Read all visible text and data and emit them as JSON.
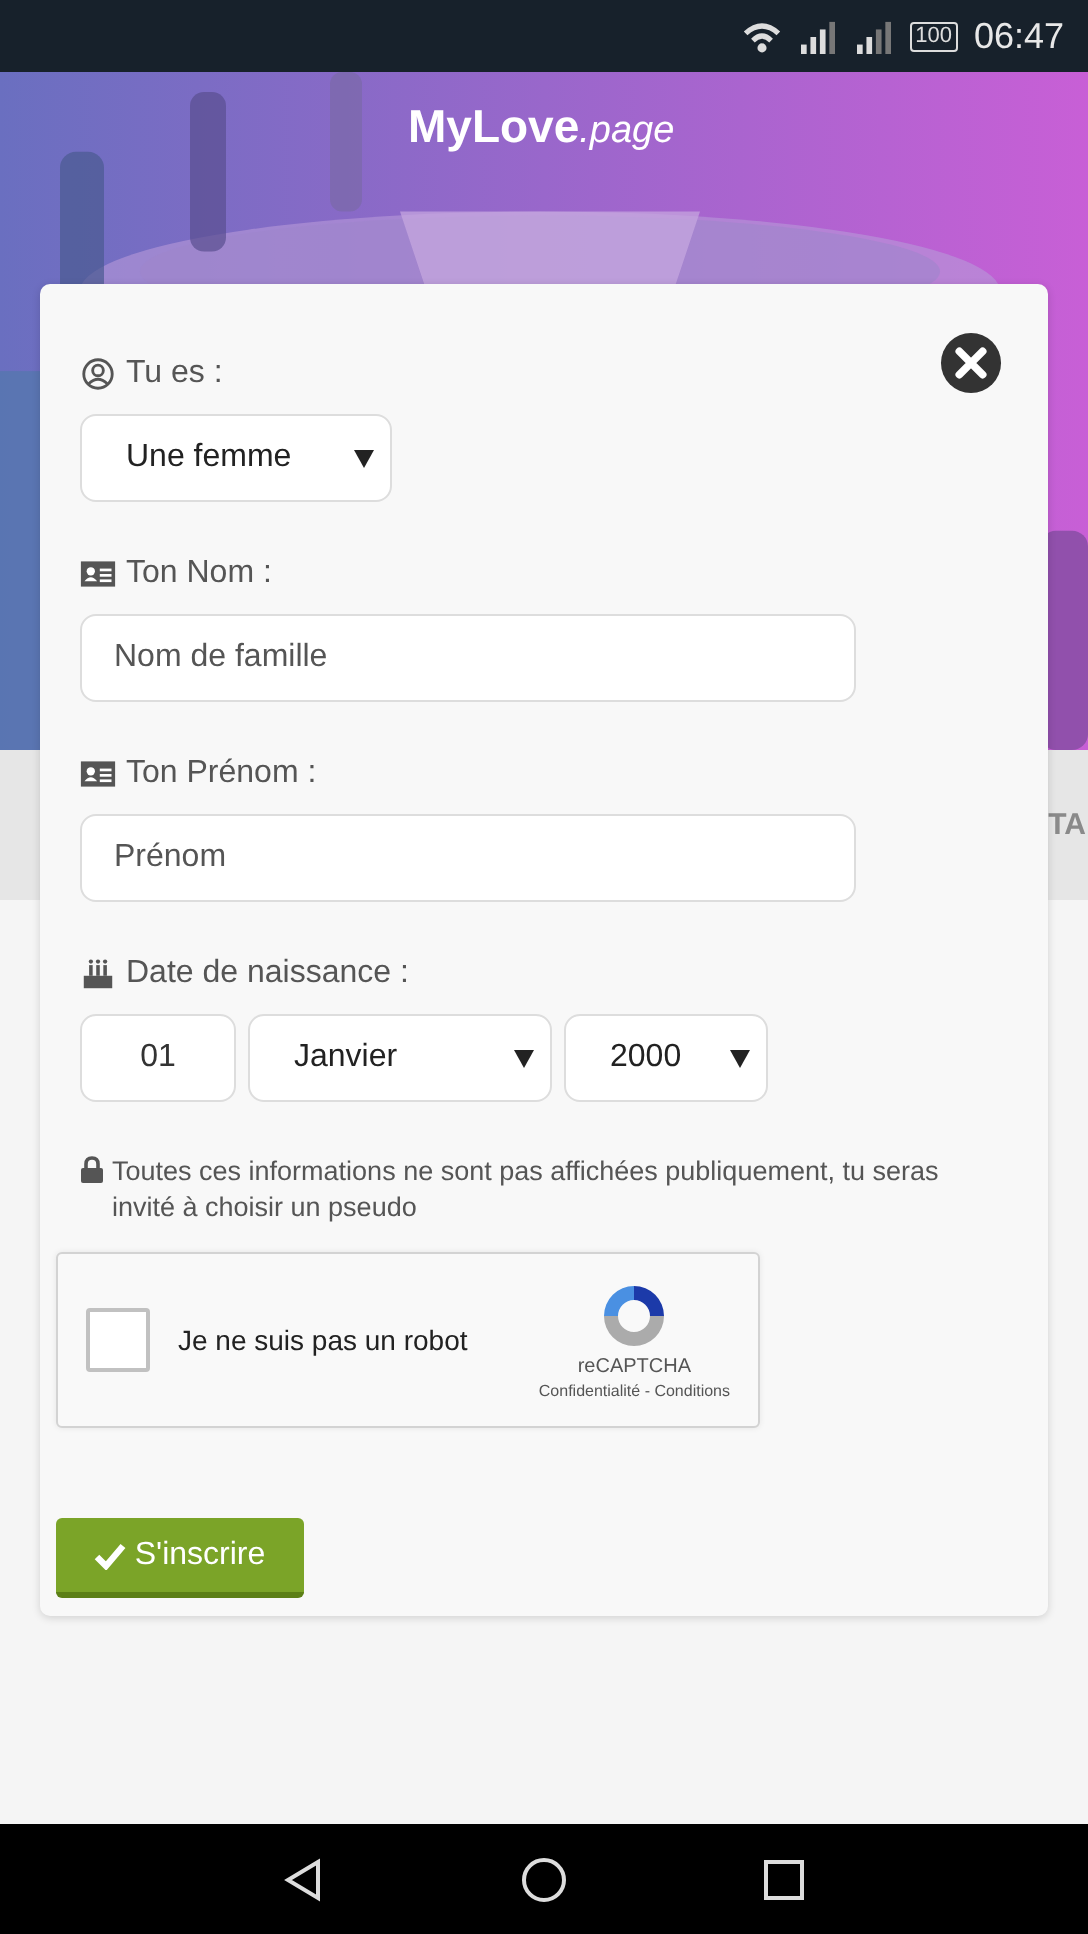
{
  "status_bar": {
    "battery": "100",
    "time": "06:47"
  },
  "header": {
    "logo": "MyLove",
    "logo_suffix": ".page"
  },
  "background_text": "TA",
  "form": {
    "sections": [
      {
        "kind": "gender",
        "label": "Tu es :",
        "value": "Une femme"
      },
      {
        "kind": "name",
        "label": "Ton Nom :",
        "placeholder": "Nom de famille"
      },
      {
        "kind": "name",
        "label": "Ton Prénom :",
        "placeholder": "Prénom"
      },
      {
        "kind": "birthdate",
        "label": "Date de naissance :",
        "day": "01",
        "month": "Janvier",
        "year": "2000"
      }
    ],
    "note": "Toutes ces informations ne sont pas affichées publiquement, tu seras invité à choisir un pseudo",
    "captcha": {
      "checked": false,
      "label": "Je ne suis pas un robot",
      "brand": "reCAPTCHA",
      "links": "Confidentialité - Conditions"
    },
    "submit": "S'inscrire"
  }
}
